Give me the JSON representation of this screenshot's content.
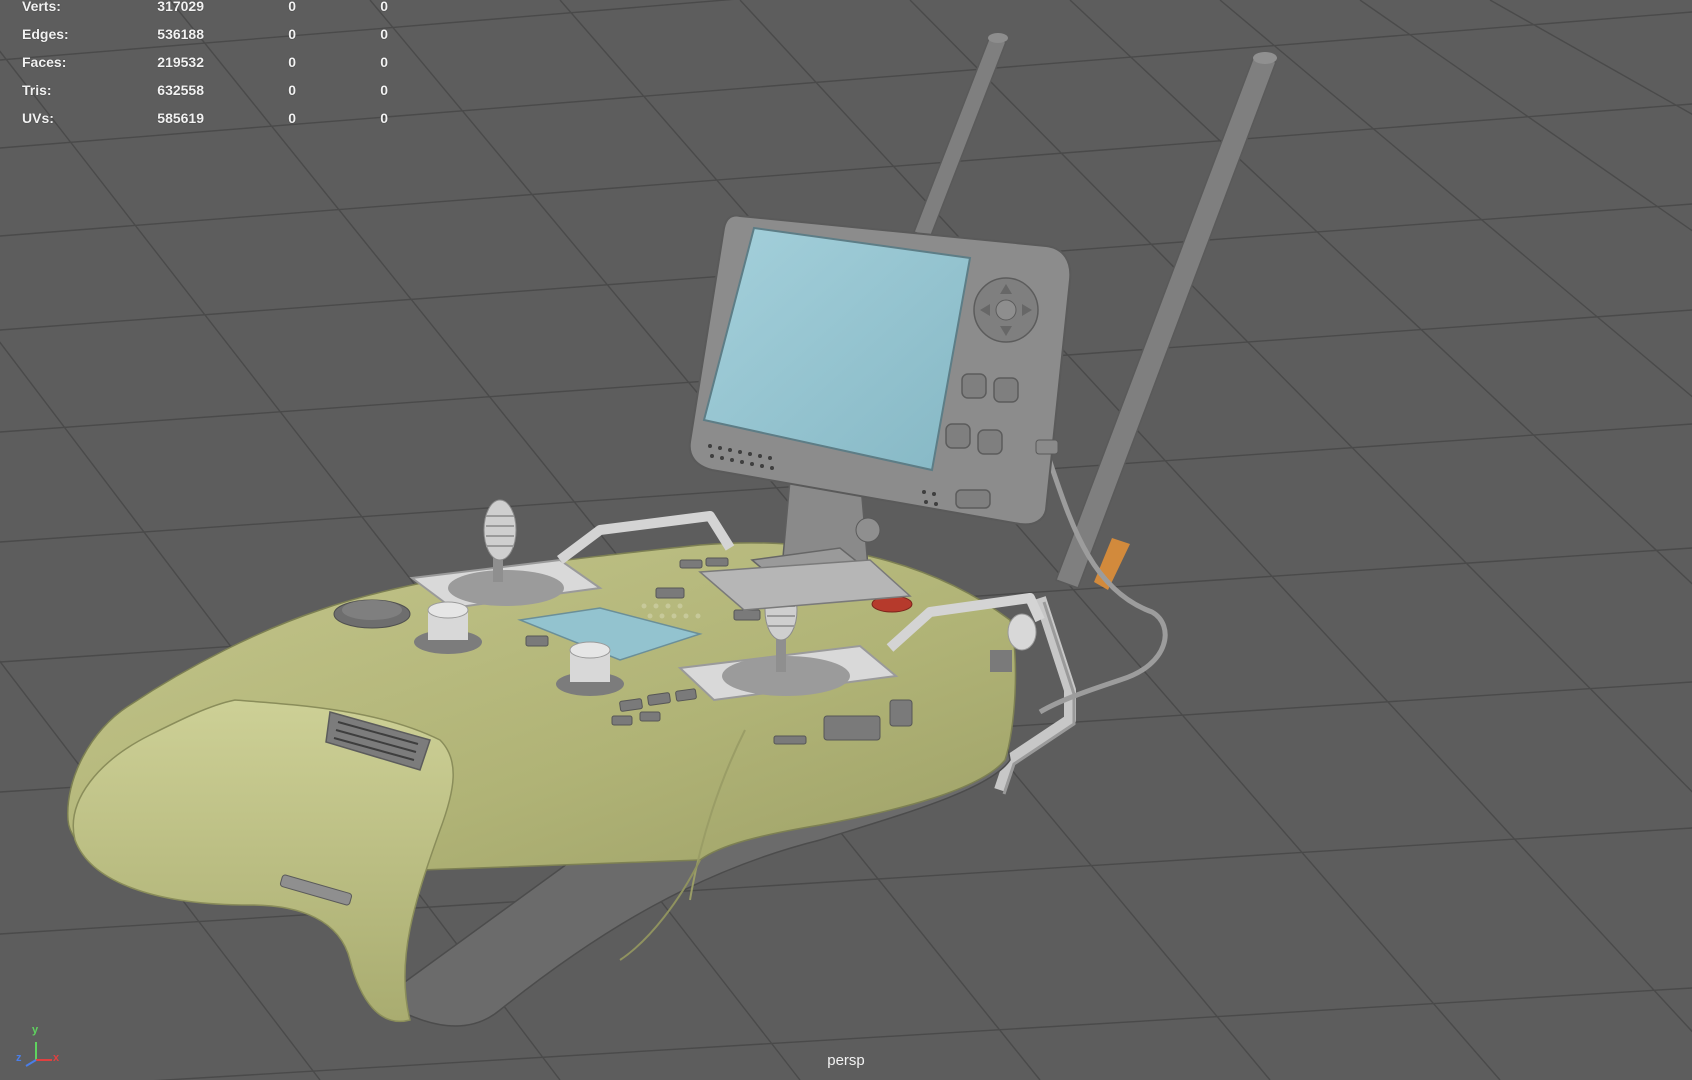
{
  "hud": {
    "rows": [
      {
        "label": "Verts:",
        "total": "317029",
        "selected": "0",
        "components": "0"
      },
      {
        "label": "Edges:",
        "total": "536188",
        "selected": "0",
        "components": "0"
      },
      {
        "label": "Faces:",
        "total": "219532",
        "selected": "0",
        "components": "0"
      },
      {
        "label": "Tris:",
        "total": "632558",
        "selected": "0",
        "components": "0"
      },
      {
        "label": "UVs:",
        "total": "585619",
        "selected": "0",
        "components": "0"
      }
    ]
  },
  "camera": "persp",
  "axes": {
    "x": "x",
    "y": "y",
    "z": "z"
  },
  "colors": {
    "viewport_bg": "#5d5d5d",
    "grid_line": "#484848",
    "body_green": "#b4b77c",
    "screen_blue": "#93c3cf",
    "module_grey": "#8a8a8a",
    "orange_tag": "#d28a3c",
    "red_button": "#b63a2c",
    "axis_x": "#e04040",
    "axis_y": "#5fd35f",
    "axis_z": "#4a7ee8"
  }
}
